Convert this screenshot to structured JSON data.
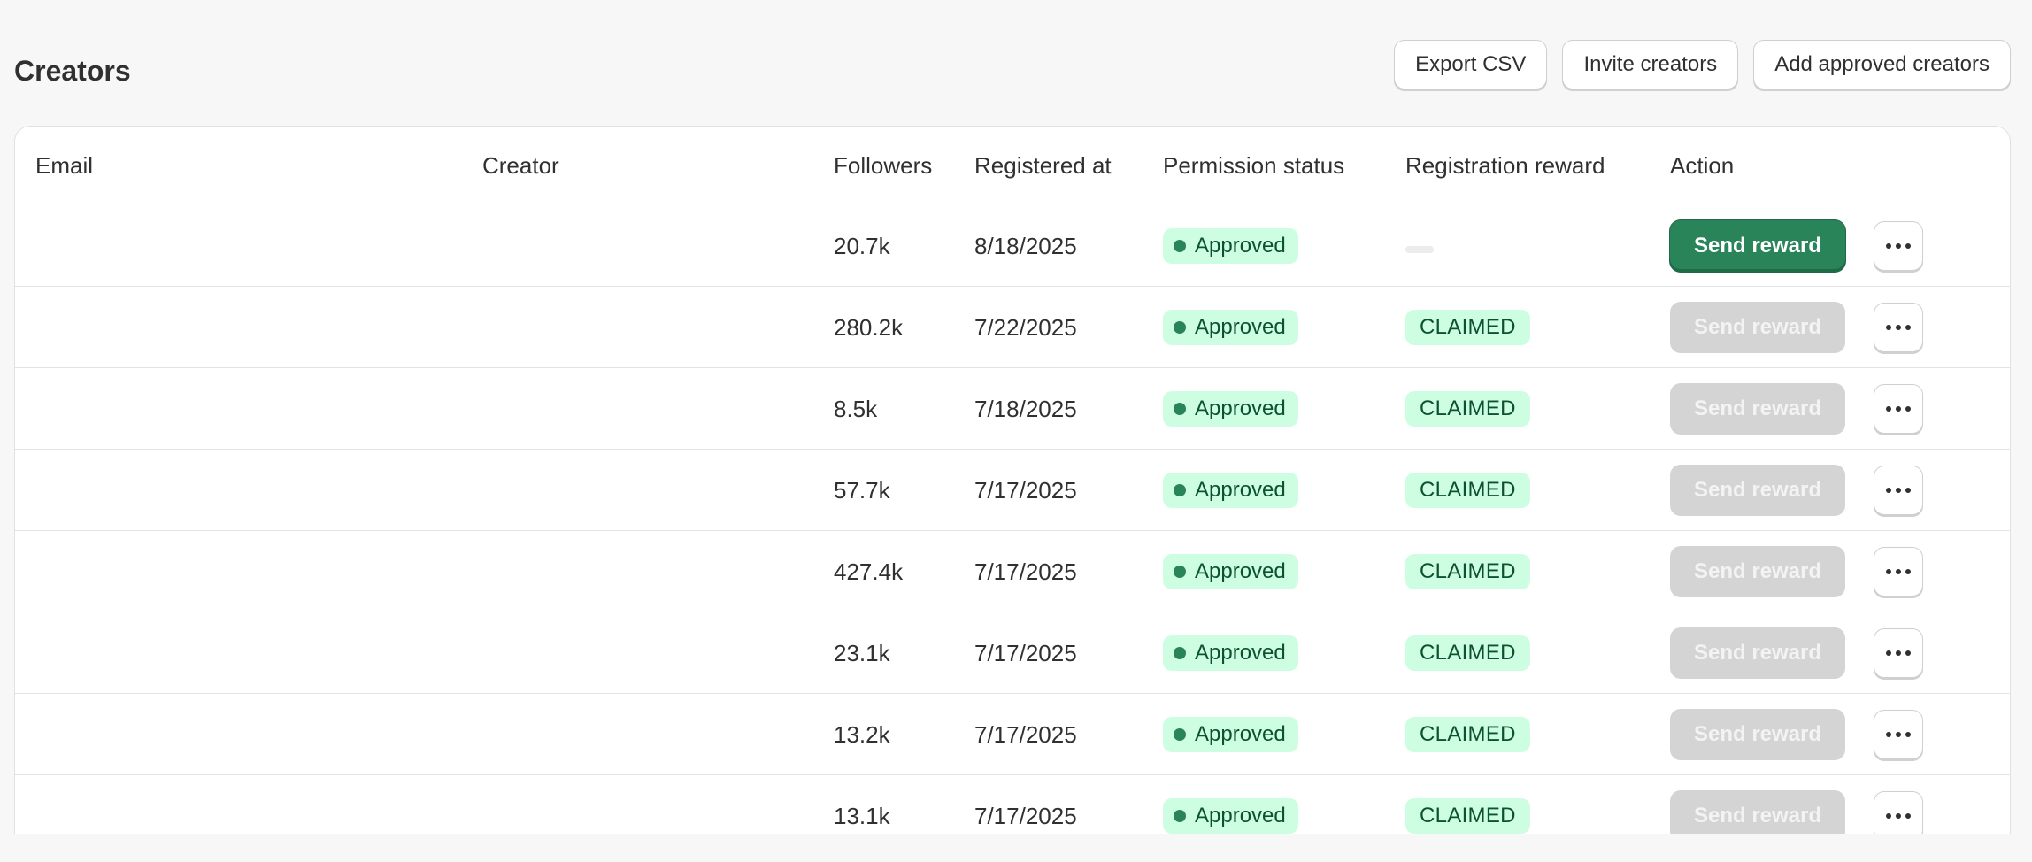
{
  "page": {
    "title": "Creators"
  },
  "header_actions": {
    "export_csv": "Export CSV",
    "invite_creators": "Invite creators",
    "add_approved_creators": "Add approved creators"
  },
  "table": {
    "columns": {
      "email": "Email",
      "creator": "Creator",
      "followers": "Followers",
      "registered_at": "Registered at",
      "permission_status": "Permission status",
      "registration_reward": "Registration reward",
      "action": "Action"
    },
    "rows": [
      {
        "email": "",
        "creator": "",
        "followers": "20.7k",
        "registered_at": "8/18/2025",
        "permission_status": "Approved",
        "registration_reward": "",
        "action_label": "Send reward",
        "action_enabled": true
      },
      {
        "email": "",
        "creator": "",
        "followers": "280.2k",
        "registered_at": "7/22/2025",
        "permission_status": "Approved",
        "registration_reward": "CLAIMED",
        "action_label": "Send reward",
        "action_enabled": false
      },
      {
        "email": "",
        "creator": "",
        "followers": "8.5k",
        "registered_at": "7/18/2025",
        "permission_status": "Approved",
        "registration_reward": "CLAIMED",
        "action_label": "Send reward",
        "action_enabled": false
      },
      {
        "email": "",
        "creator": "",
        "followers": "57.7k",
        "registered_at": "7/17/2025",
        "permission_status": "Approved",
        "registration_reward": "CLAIMED",
        "action_label": "Send reward",
        "action_enabled": false
      },
      {
        "email": "",
        "creator": "",
        "followers": "427.4k",
        "registered_at": "7/17/2025",
        "permission_status": "Approved",
        "registration_reward": "CLAIMED",
        "action_label": "Send reward",
        "action_enabled": false
      },
      {
        "email": "",
        "creator": "",
        "followers": "23.1k",
        "registered_at": "7/17/2025",
        "permission_status": "Approved",
        "registration_reward": "CLAIMED",
        "action_label": "Send reward",
        "action_enabled": false
      },
      {
        "email": "",
        "creator": "",
        "followers": "13.2k",
        "registered_at": "7/17/2025",
        "permission_status": "Approved",
        "registration_reward": "CLAIMED",
        "action_label": "Send reward",
        "action_enabled": false
      },
      {
        "email": "",
        "creator": "",
        "followers": "13.1k",
        "registered_at": "7/17/2025",
        "permission_status": "Approved",
        "registration_reward": "CLAIMED",
        "action_label": "Send reward",
        "action_enabled": false
      }
    ]
  },
  "icons": {
    "more": "more-horizontal-icon",
    "status": "status-dot-icon"
  },
  "colors": {
    "primary_button": "#29845a",
    "badge_background": "#cdfee1",
    "badge_text": "#0c5132",
    "disabled_button": "#d4d4d4"
  }
}
